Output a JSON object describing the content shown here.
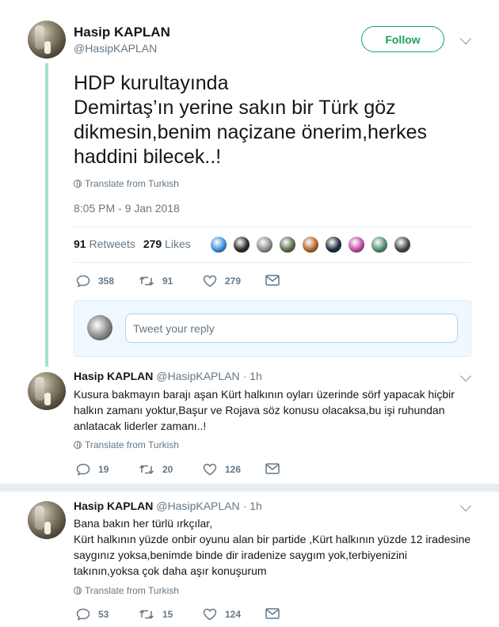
{
  "main_tweet": {
    "author_name": "Hasip KAPLAN",
    "author_handle": "@HasipKAPLAN",
    "follow_label": "Follow",
    "text_lines": [
      "HDP kurultayında",
      "Demirtaş’ın yerine sakın  bir Türk göz",
      "dikmesin,benim naçizane önerim,herkes",
      "haddini bilecek..!"
    ],
    "translate_label": "Translate from Turkish",
    "timestamp": "8:05 PM - 9 Jan 2018",
    "retweets_count": "91",
    "retweets_label": "Retweets",
    "likes_count": "279",
    "likes_label": "Likes",
    "actions": {
      "replies": "358",
      "retweets": "91",
      "likes": "279"
    }
  },
  "liker_avatar_colors": [
    "#3b8fd9",
    "#2a2a2a",
    "#8a8a8a",
    "#5a6b4a",
    "#b0642b",
    "#1c2a3a",
    "#c04aa8",
    "#4f8c6a",
    "#444444"
  ],
  "reply_box": {
    "placeholder": "Tweet your reply"
  },
  "replies": [
    {
      "author_name": "Hasip KAPLAN",
      "author_handle": "@HasipKAPLAN",
      "time": "· 1h",
      "text_lines": [
        "Kusura bakmayın barajı aşan Kürt halkının oyları üzerinde sörf yapacak hiçbir",
        "halkın zamanı yoktur,Başur ve Rojava söz konusu olacaksa,bu işi ruhundan",
        "anlatacak liderler zamanı..!"
      ],
      "translate_label": "Translate from Turkish",
      "actions": {
        "replies": "19",
        "retweets": "20",
        "likes": "126"
      }
    },
    {
      "author_name": "Hasip KAPLAN",
      "author_handle": "@HasipKAPLAN",
      "time": "· 1h",
      "text_lines": [
        "Bana bakın her türlü ırkçılar,",
        "Kürt halkının yüzde onbir oyunu alan bir partide ,Kürt halkının yüzde 12 iradesine",
        "saygınız yoksa,benimde binde dir iradenize saygım yok,terbiyenizini",
        "takının,yoksa çok daha aşır konuşurum"
      ],
      "translate_label": "Translate from Turkish",
      "actions": {
        "replies": "53",
        "retweets": "15",
        "likes": "124"
      }
    }
  ],
  "colors": {
    "accent_green": "#19a35f",
    "thread_line": "#a3e2c7",
    "muted_text": "#657786"
  }
}
